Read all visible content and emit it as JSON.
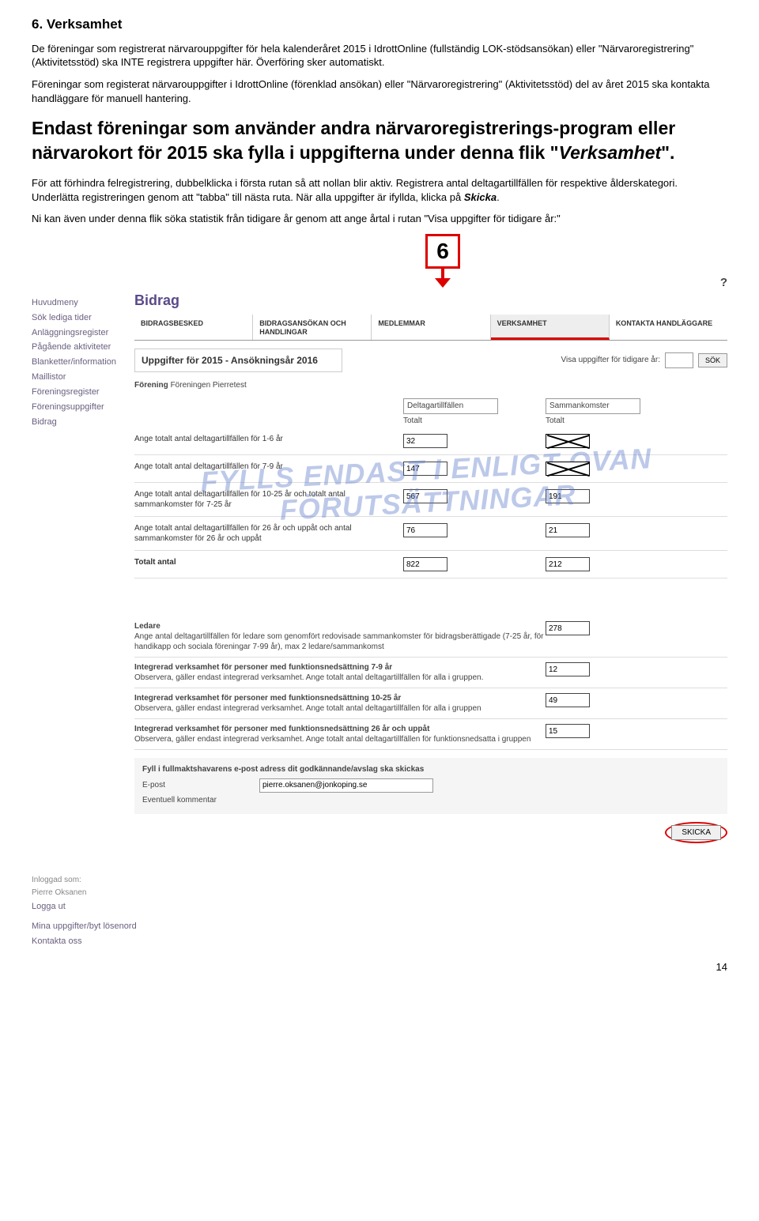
{
  "doc": {
    "section_title": "6. Verksamhet",
    "p1": "De föreningar som registrerat närvarouppgifter för hela kalenderåret 2015 i IdrottOnline (fullständig LOK-stödsansökan) eller \"Närvaroregistrering\" (Aktivitetsstöd) ska INTE registrera uppgifter här. Överföring sker automatiskt.",
    "p2": "Föreningar som registerat närvarouppgifter i IdrottOnline (förenklad ansökan) eller \"Närvaroregistrering\" (Aktivitetsstöd) del av året 2015 ska kontakta handläggare för manuell hantering.",
    "big": "Endast föreningar som använder andra närvaroregistrerings-program eller närvarokort för 2015 ska fylla i uppgifterna under denna flik \"",
    "big_ital": "Verksamhet",
    "big_end": "\".",
    "p3_a": "För att förhindra felregistrering, dubbelklicka i första rutan så att nollan blir aktiv. Registrera antal deltagartillfällen för respektive ålderskategori. Underlätta registreringen genom att \"tabba\" till nästa ruta. När alla uppgifter är ifyllda, klicka på ",
    "p3_b": "Skicka",
    "p3_c": ".",
    "p4": "Ni kan även under denna flik söka statistik från tidigare år genom att ange årtal i rutan \"Visa uppgifter för tidigare år:\"",
    "page_number": "14"
  },
  "callout": {
    "number": "6",
    "helpq": "?"
  },
  "sidebar": {
    "items": [
      "Huvudmeny",
      "Sök lediga tider",
      "Anläggningsregister",
      "Pågående aktiviteter",
      "Blanketter/information",
      "Maillistor",
      "Föreningsregister",
      "Föreningsuppgifter",
      "Bidrag"
    ],
    "logged": "Inloggad som:",
    "user": "Pierre Oksanen",
    "logout": "Logga ut",
    "myinfo": "Mina uppgifter/byt lösenord",
    "contact": "Kontakta oss"
  },
  "main": {
    "title": "Bidrag",
    "tabs": [
      "BIDRAGSBESKED",
      "BIDRAGSANSÖKAN OCH HANDLINGAR",
      "MEDLEMMAR",
      "VERKSAMHET",
      "KONTAKTA HANDLÄGGARE"
    ],
    "uppg": "Uppgifter för 2015  -  Ansökningsår 2016",
    "visa": "Visa uppgifter för tidigare år:",
    "sok": "SÖK",
    "foren_lbl": "Förening",
    "foren_val": "Föreningen Pierretest",
    "col1": "Deltagartillfällen",
    "col1b": "Totalt",
    "col2": "Sammankomster",
    "col2b": "Totalt",
    "rows": [
      {
        "desc": "Ange totalt antal deltagartillfällen för 1-6 år",
        "v1": "32",
        "v2_cross": true
      },
      {
        "desc": "Ange totalt antal deltagartillfällen för 7-9 år",
        "v1": "147",
        "v2_cross": true
      },
      {
        "desc": "Ange totalt antal deltagartillfällen för 10-25 år och totalt antal sammankomster för 7-25 år",
        "v1": "567",
        "v2": "191"
      },
      {
        "desc": "Ange totalt antal deltagartillfällen för 26 år och uppåt och antal sammankomster för 26 år och uppåt",
        "v1": "76",
        "v2": "21"
      }
    ],
    "tot_lbl": "Totalt antal",
    "tot_v1": "822",
    "tot_v2": "212",
    "watermark_l1": "FYLLS ENDAST I ENLIGT OVAN",
    "watermark_l2": "FÖRUTSÄTTNINGAR",
    "blocks": [
      {
        "title": "Ledare",
        "body": "Ange antal deltagartillfällen för ledare som genomfört redovisade sammankomster för bidragsberättigade (7-25 år, för handikapp och sociala föreningar 7-99 år), max 2 ledare/sammankomst",
        "val": "278"
      },
      {
        "title": "Integrerad verksamhet för personer med funktionsnedsättning 7-9 år",
        "body": "Observera, gäller endast integrerad verksamhet. Ange totalt antal deltagartillfällen för alla i gruppen.",
        "val": "12"
      },
      {
        "title": "Integrerad verksamhet för personer med funktionsnedsättning 10-25 år",
        "body": "Observera, gäller endast integrerad verksamhet. Ange totalt antal deltagartillfällen för alla i gruppen",
        "val": "49"
      },
      {
        "title": "Integrerad verksamhet för personer med funktionsnedsättning 26 år och uppåt",
        "body": "Observera, gäller endast integrerad verksamhet. Ange totalt antal deltagartillfällen för funktionsnedsatta i gruppen",
        "val": "15"
      }
    ],
    "email_hd": "Fyll i fullmaktshavarens e-post adress dit godkännande/avslag ska skickas",
    "email_lbl": "E-post",
    "email_val": "pierre.oksanen@jonkoping.se",
    "comment_lbl": "Eventuell kommentar",
    "skicka": "SKICKA"
  }
}
